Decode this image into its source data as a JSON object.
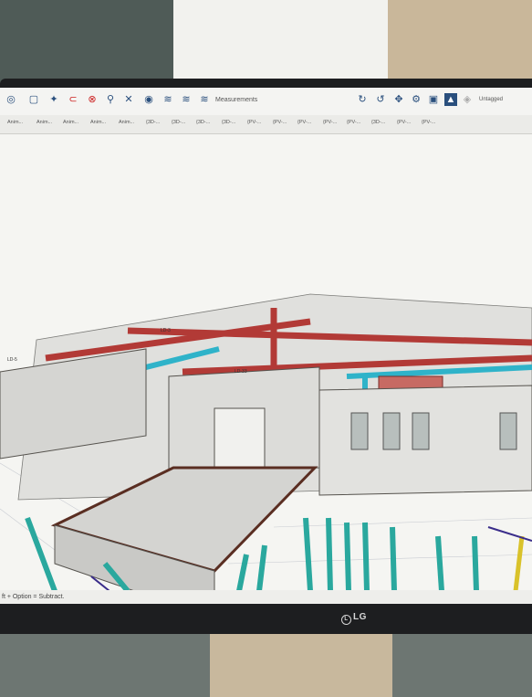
{
  "toolbar": {
    "icons": [
      "measure-icon",
      "comment-icon",
      "walk-icon",
      "orbit-icon",
      "pin-icon",
      "zoom-icon",
      "fit-icon",
      "section-icon",
      "layers-icon",
      "stack-icon",
      "clash-icon"
    ],
    "measurements_label": "Measurements",
    "right_icons": [
      "rotate-icon",
      "look-icon",
      "pan-icon",
      "settings-icon",
      "tag-icon",
      "filter-icon",
      "cube-icon"
    ],
    "tag_select": "Untagged"
  },
  "tabs": [
    "Anim...",
    "Anim...",
    "Anim...",
    "Anim...",
    "Anim...",
    "{3D-...",
    "{3D-...",
    "{3D-...",
    "{3D-...",
    "{PV-...",
    "{PV-...",
    "{PV-...",
    "{PV-...",
    "{PV-...",
    "{3D-...",
    "{PV-...",
    "{PV-..."
  ],
  "model_labels": [
    "LD-5",
    "LD-3",
    "LD-33"
  ],
  "status_text": "ft + Option = Subtract.",
  "brand": "LG",
  "colors": {
    "pipe_red": "#b23a36",
    "duct_cyan": "#2fb3c9",
    "column_teal": "#2aa89e",
    "slab": "#d9d9d6",
    "beam_brown": "#5a2e22"
  }
}
